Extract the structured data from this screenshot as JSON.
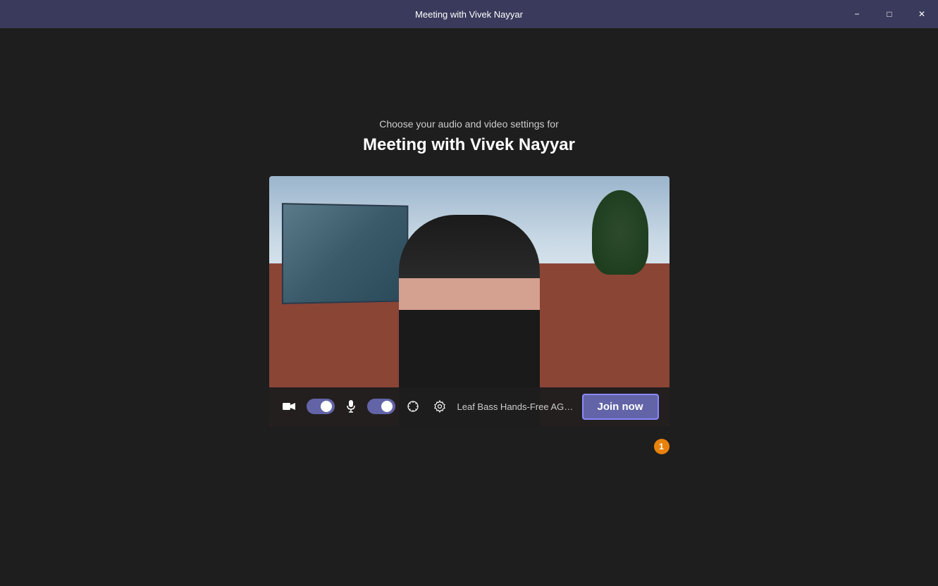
{
  "titlebar": {
    "title": "Meeting with Vivek Nayyar",
    "minimize_label": "−",
    "maximize_label": "□",
    "close_label": "✕"
  },
  "main": {
    "subtitle": "Choose your audio and video settings for",
    "meeting_title": "Meeting with Vivek Nayyar"
  },
  "controls": {
    "audio_device": "Leaf Bass Hands-Free AG Au...",
    "join_now_label": "Join now",
    "badge_count": "1",
    "video_toggle_on": true,
    "mic_toggle_on": true
  }
}
